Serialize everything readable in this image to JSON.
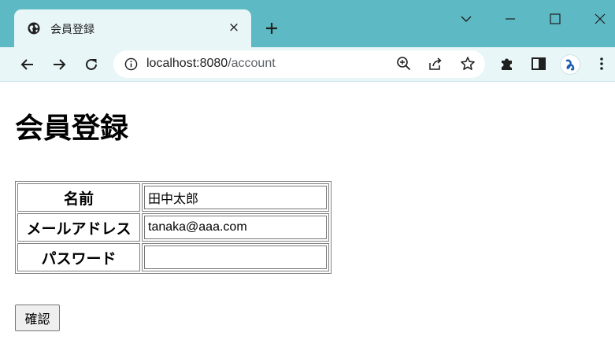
{
  "browser": {
    "tab": {
      "title": "会員登録",
      "close": "×"
    },
    "address_bar": {
      "host": "localhost:8080",
      "path": "/account"
    },
    "colors": {
      "frame": "#5db9c3",
      "toolbar": "#e9f6f8",
      "profile_accent": "#1a5fb4"
    },
    "icons": {
      "favicon": "globe-icon",
      "new_tab": "plus-icon",
      "minimize": "minimize-icon",
      "maximize": "maximize-icon",
      "close_window": "close-icon",
      "tab_search": "chevron-down-icon",
      "back": "arrow-left-icon",
      "forward": "arrow-right-icon",
      "reload": "reload-icon",
      "site_info": "info-icon",
      "zoom": "zoom-icon",
      "share": "share-icon",
      "bookmark": "star-icon",
      "extensions": "puzzle-icon",
      "side_panel": "side-panel-icon",
      "profile": "profile-avatar",
      "menu": "kebab-menu-icon"
    }
  },
  "page": {
    "title": "会員登録",
    "form": {
      "rows": [
        {
          "label": "名前",
          "value": "田中太郎"
        },
        {
          "label": "メールアドレス",
          "value": "tanaka@aaa.com"
        },
        {
          "label": "パスワード",
          "value": ""
        }
      ],
      "submit_label": "確認"
    }
  }
}
